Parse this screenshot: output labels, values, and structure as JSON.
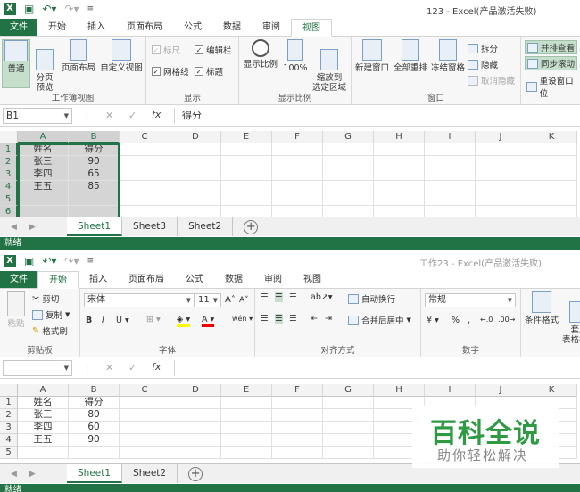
{
  "w1": {
    "title": "123 - Excel(产品激活失败)",
    "tabs": [
      "文件",
      "开始",
      "插入",
      "页面布局",
      "公式",
      "数据",
      "审阅",
      "视图"
    ],
    "active_tab": "视图",
    "ribbon": {
      "normal": "普通",
      "page_break": "分页\n预览",
      "page_layout": "页面布局",
      "custom_view": "自定义视图",
      "group_views": "工作簿视图",
      "ruler": "标尺",
      "formula_bar": "编辑栏",
      "gridlines": "网格线",
      "headings": "标题",
      "group_show": "显示",
      "zoom": "显示比例",
      "zoom100": "100%",
      "zoom_sel": "缩放到\n选定区域",
      "group_zoom": "显示比例",
      "new_window": "新建窗口",
      "arrange_all": "全部重排",
      "freeze": "冻结窗格",
      "split": "拆分",
      "hide": "隐藏",
      "unhide": "取消隐藏",
      "side_by_side": "并排查看",
      "sync_scroll": "同步滚动",
      "reset_pos": "重设窗口位",
      "group_window": "窗口"
    },
    "namebox": "B1",
    "formula": "得分",
    "columns": [
      "A",
      "B",
      "C",
      "D",
      "E",
      "F",
      "G",
      "H",
      "I",
      "J",
      "K"
    ],
    "rows": [
      "1",
      "2",
      "3",
      "4",
      "5",
      "6"
    ],
    "cells": [
      [
        "姓名",
        "得分"
      ],
      [
        "张三",
        "90"
      ],
      [
        "李四",
        "65"
      ],
      [
        "王五",
        "85"
      ],
      [
        "",
        ""
      ],
      [
        "",
        ""
      ]
    ],
    "sheets": [
      "Sheet1",
      "Sheet3",
      "Sheet2"
    ],
    "active_sheet": "Sheet1",
    "status": "就绪"
  },
  "w2": {
    "title": "工作23 - Excel(产品激活失败)",
    "tabs": [
      "文件",
      "开始",
      "插入",
      "页面布局",
      "公式",
      "数据",
      "审阅",
      "视图"
    ],
    "active_tab": "开始",
    "ribbon": {
      "paste": "粘贴",
      "cut": "剪切",
      "copy": "复制",
      "format_painter": "格式刷",
      "group_clipboard": "剪贴板",
      "font_name": "宋体",
      "font_size": "11",
      "group_font": "字体",
      "wrap": "自动换行",
      "merge": "合并后居中",
      "group_align": "对齐方式",
      "number_format": "常规",
      "group_number": "数字",
      "cond_format": "条件格式",
      "table_format": "套用\n表格格式"
    },
    "namebox": "",
    "formula": "",
    "columns": [
      "A",
      "B",
      "C",
      "D",
      "E",
      "F",
      "G",
      "H",
      "I",
      "J",
      "K"
    ],
    "rows": [
      "1",
      "2",
      "3",
      "4",
      "5"
    ],
    "cells": [
      [
        "姓名",
        "得分"
      ],
      [
        "张三",
        "80"
      ],
      [
        "李四",
        "60"
      ],
      [
        "王五",
        "90"
      ],
      [
        "",
        ""
      ]
    ],
    "sheets": [
      "Sheet1",
      "Sheet2"
    ],
    "active_sheet": "Sheet1",
    "status": "就绪"
  },
  "watermark": {
    "brand": "百科全说",
    "slogan": "助你轻松解决"
  },
  "colors": {
    "accent": "#217346",
    "watermark": "#2e9a42"
  }
}
